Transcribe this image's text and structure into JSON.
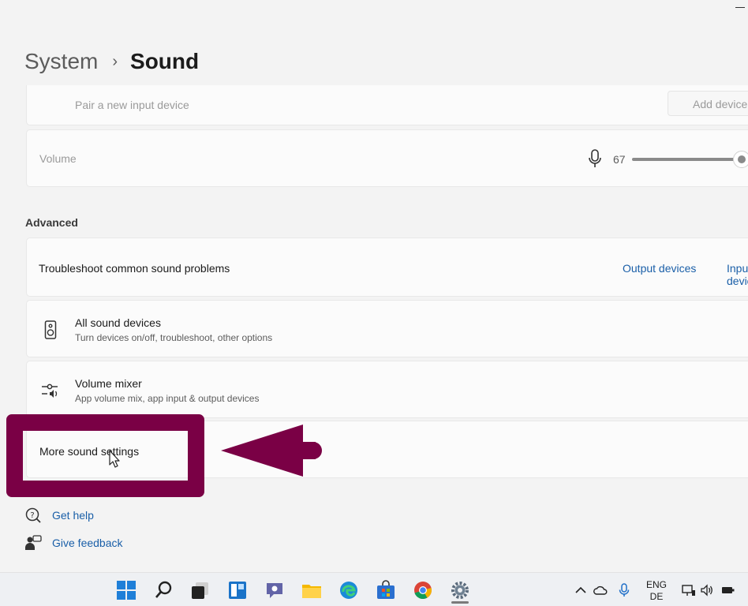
{
  "breadcrumb": {
    "parent": "System",
    "separator": "›",
    "current": "Sound"
  },
  "input_section": {
    "pair_label": "Pair a new input device",
    "add_button_label": "Add device",
    "volume_label": "Volume",
    "volume_value": "67",
    "volume_level_percent": 67
  },
  "advanced": {
    "heading": "Advanced",
    "troubleshoot": {
      "label": "Troubleshoot common sound problems",
      "link_output": "Output devices",
      "link_input": "Input devices"
    },
    "all_devices": {
      "title": "All sound devices",
      "subtitle": "Turn devices on/off, troubleshoot, other options",
      "icon": "speaker-icon"
    },
    "mixer": {
      "title": "Volume mixer",
      "subtitle": "App volume mix, app input & output devices",
      "icon": "mixer-icon"
    },
    "more_settings": {
      "label": "More sound settings"
    }
  },
  "help": {
    "get_help": "Get help",
    "give_feedback": "Give feedback"
  },
  "annotation": {
    "color": "#7a0045"
  },
  "taskbar": {
    "icons": [
      "windows-start-icon",
      "search-icon",
      "task-view-icon",
      "widgets-icon",
      "teams-chat-icon",
      "file-explorer-icon",
      "edge-icon",
      "store-icon",
      "chrome-icon",
      "settings-icon"
    ],
    "tray": {
      "lang_line1": "ENG",
      "lang_line2": "DE"
    }
  },
  "colors": {
    "accent_link": "#1a5fa8",
    "background": "#f3f3f3",
    "card": "#fbfbfb"
  }
}
